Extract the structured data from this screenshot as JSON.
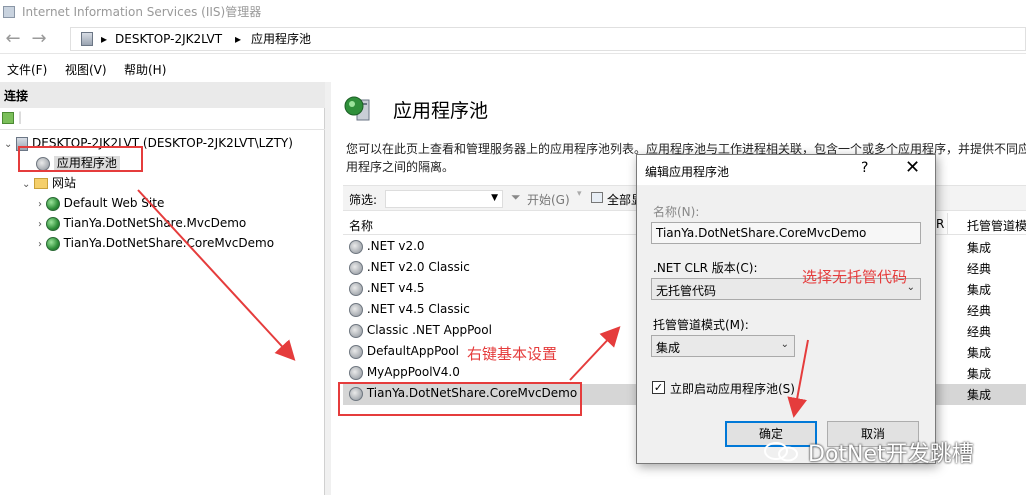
{
  "window": {
    "title": "Internet Information Services (IIS)管理器"
  },
  "address": {
    "crumbs": [
      "DESKTOP-2JK2LVT",
      "应用程序池"
    ]
  },
  "menu": {
    "file": "文件(F)",
    "view": "视图(V)",
    "help": "帮助(H)"
  },
  "connections": {
    "header": "连接",
    "server": "DESKTOP-2JK2LVT (DESKTOP-2JK2LVT\\LZTY)",
    "app_pools": "应用程序池",
    "sites": "网站",
    "site_items": [
      "Default Web Site",
      "TianYa.DotNetShare.MvcDemo",
      "TianYa.DotNetShare.CoreMvcDemo"
    ]
  },
  "main": {
    "title": "应用程序池",
    "description": "您可以在此页上查看和管理服务器上的应用程序池列表。应用程序池与工作进程相关联，包含一个或多个应用程序，并提供不同应用程序之间的隔离。",
    "filter_label": "筛选:",
    "start_label": "开始(G)",
    "show_all_label": "全部显示(A)",
    "col_name": "名称",
    "col_partial": "R",
    "col_mode": "托管管道模式",
    "rows": [
      {
        "name": ".NET v2.0",
        "mode": "集成"
      },
      {
        "name": ".NET v2.0 Classic",
        "mode": "经典"
      },
      {
        "name": ".NET v4.5",
        "mode": "集成"
      },
      {
        "name": ".NET v4.5 Classic",
        "mode": "经典"
      },
      {
        "name": "Classic .NET AppPool",
        "mode": "经典"
      },
      {
        "name": "DefaultAppPool",
        "mode": "集成"
      },
      {
        "name": "MyAppPoolV4.0",
        "mode": "集成"
      },
      {
        "name": "TianYa.DotNetShare.CoreMvcDemo",
        "mode": "集成"
      }
    ],
    "selected_row": 7
  },
  "dialog": {
    "title": "编辑应用程序池",
    "help": "?",
    "close": "✕",
    "name_label": "名称(N):",
    "name_value": "TianYa.DotNetShare.CoreMvcDemo",
    "clr_label": ".NET CLR 版本(C):",
    "clr_value": "无托管代码",
    "pipeline_label": "托管管道模式(M):",
    "pipeline_value": "集成",
    "autostart_label": "立即启动应用程序池(S)",
    "autostart_checked": true,
    "ok": "确定",
    "cancel": "取消"
  },
  "annotations": {
    "right_click_note": "右键基本设置",
    "choose_note": "选择无托管代码",
    "accent": "#e53c3c"
  },
  "watermark": {
    "text": "DotNet开发跳槽"
  }
}
